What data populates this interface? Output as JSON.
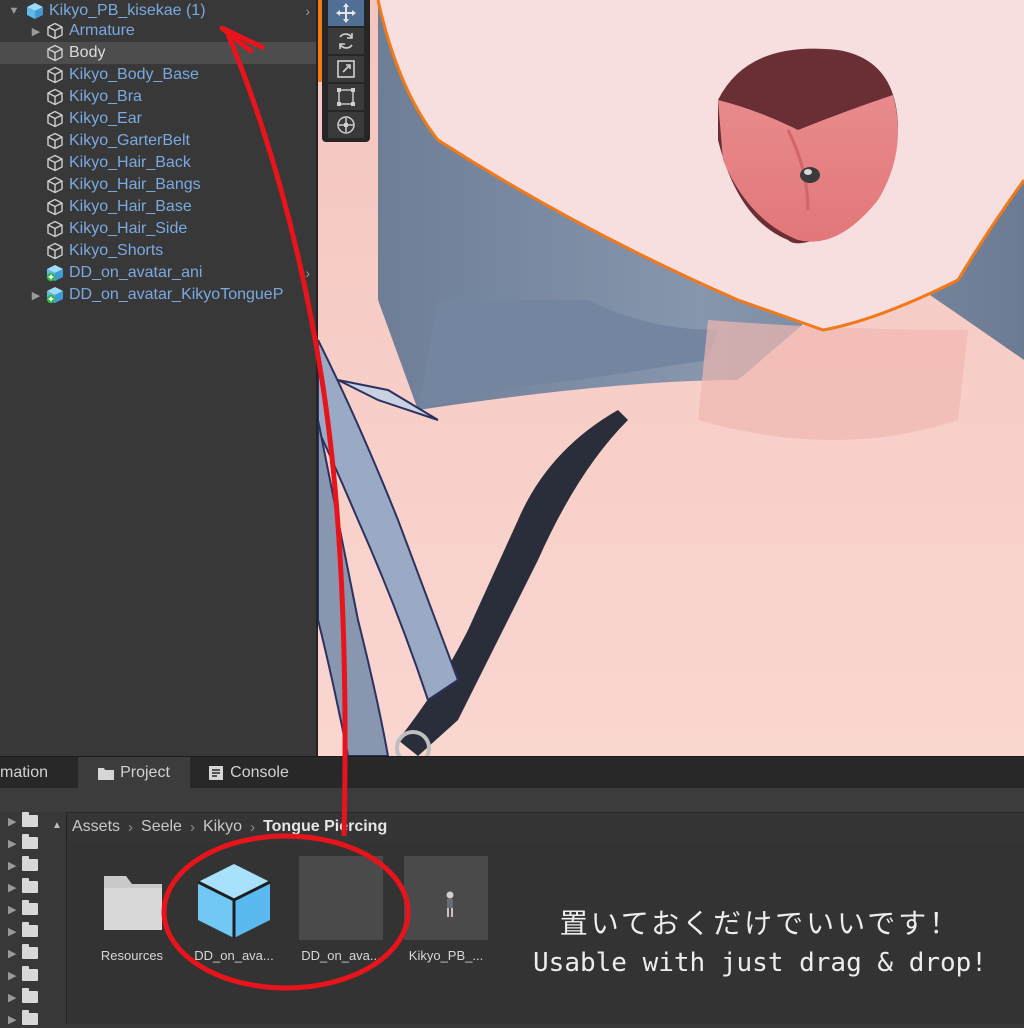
{
  "hierarchy": {
    "items": [
      {
        "label": "Kikyo_PB_kisekae (1)",
        "icon": "prefab-icon",
        "expanded": true,
        "has_chevron": true
      },
      {
        "label": "Armature",
        "icon": "gameobject-icon",
        "expanded": false,
        "has_chevron": false
      },
      {
        "label": "Body",
        "icon": "gameobject-icon",
        "selected": true
      },
      {
        "label": "Kikyo_Body_Base",
        "icon": "gameobject-icon"
      },
      {
        "label": "Kikyo_Bra",
        "icon": "gameobject-icon"
      },
      {
        "label": "Kikyo_Ear",
        "icon": "gameobject-icon"
      },
      {
        "label": "Kikyo_GarterBelt",
        "icon": "gameobject-icon"
      },
      {
        "label": "Kikyo_Hair_Back",
        "icon": "gameobject-icon"
      },
      {
        "label": "Kikyo_Hair_Bangs",
        "icon": "gameobject-icon"
      },
      {
        "label": "Kikyo_Hair_Base",
        "icon": "gameobject-icon"
      },
      {
        "label": "Kikyo_Hair_Side",
        "icon": "gameobject-icon"
      },
      {
        "label": "Kikyo_Shorts",
        "icon": "gameobject-icon"
      },
      {
        "label": "DD_on_avatar_ani",
        "icon": "prefab-added-icon",
        "has_chevron": true
      },
      {
        "label": "DD_on_avatar_KikyoTongueP",
        "icon": "prefab-added-icon",
        "has_chevron": true
      }
    ]
  },
  "tabs": [
    {
      "label": "mation",
      "icon": ""
    },
    {
      "label": "Project",
      "icon": "folder-icon",
      "active": true
    },
    {
      "label": "Console",
      "icon": "console-icon"
    }
  ],
  "breadcrumb": [
    "Assets",
    "Seele",
    "Kikyo",
    "Tongue Piercing"
  ],
  "assets": [
    {
      "label": "Resources",
      "icon": "folder-icon"
    },
    {
      "label": "DD_on_ava...",
      "icon": "prefab-icon"
    },
    {
      "label": "DD_on_ava...",
      "icon": "empty-asset-icon"
    },
    {
      "label": "Kikyo_PB_...",
      "icon": "avatar-prefab-icon"
    }
  ],
  "caption": {
    "jp": "置いておくだけでいいです！",
    "en": "Usable with just drag & drop!"
  },
  "colors": {
    "selection_outline": "#f07a1a",
    "annotation_red": "#e8141c",
    "hierarchy_text": "#7ba9e0",
    "prefab_cube": "#72c8f4"
  }
}
